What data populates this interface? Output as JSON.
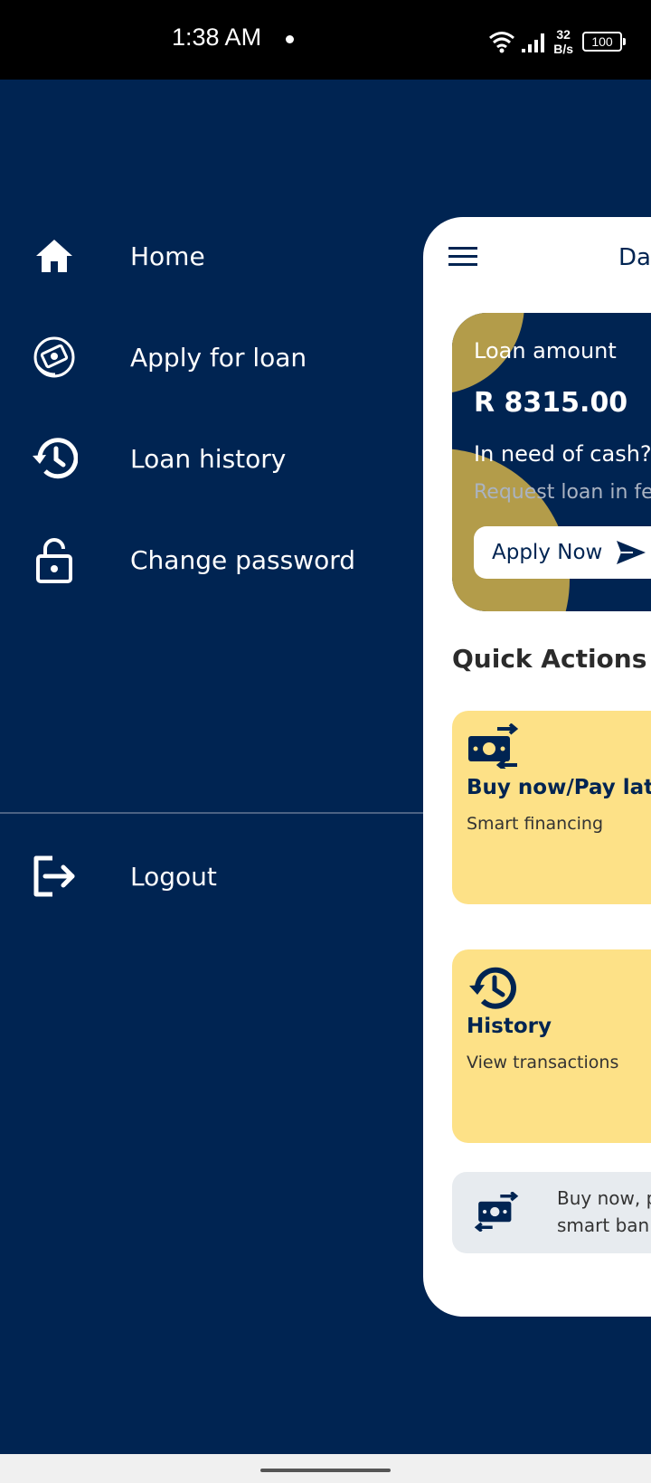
{
  "status_bar": {
    "time": "1:38 AM",
    "net_speed_value": "32",
    "net_speed_unit": "B/s",
    "battery": "100"
  },
  "drawer": {
    "items": [
      {
        "label": "Home",
        "icon": "home-icon"
      },
      {
        "label": "Apply for loan",
        "icon": "money-hand-icon"
      },
      {
        "label": "Loan history",
        "icon": "history-icon"
      },
      {
        "label": "Change password",
        "icon": "lock-icon"
      }
    ],
    "logout": {
      "label": "Logout",
      "icon": "logout-icon"
    }
  },
  "main": {
    "title": "Da",
    "loan_card": {
      "label": "Loan amount",
      "amount": "R 8315.00",
      "headline": "In need of cash?",
      "subtext": "Request loan in fe",
      "button_label": "Apply Now"
    },
    "quick_actions_title": "Quick Actions",
    "quick_actions": [
      {
        "title": "Buy now/Pay later",
        "subtitle": "Smart financing",
        "icon": "money-exchange-icon"
      },
      {
        "title": "History",
        "subtitle": "View transactions",
        "icon": "history-icon"
      }
    ],
    "promo": {
      "line1": "Buy now, p",
      "line2": "smart ban",
      "icon": "money-exchange-icon"
    }
  },
  "colors": {
    "navy": "#002452",
    "gold": "#b39c4a",
    "yellow_card": "#fde187",
    "promo_bg": "#e7ebef"
  }
}
